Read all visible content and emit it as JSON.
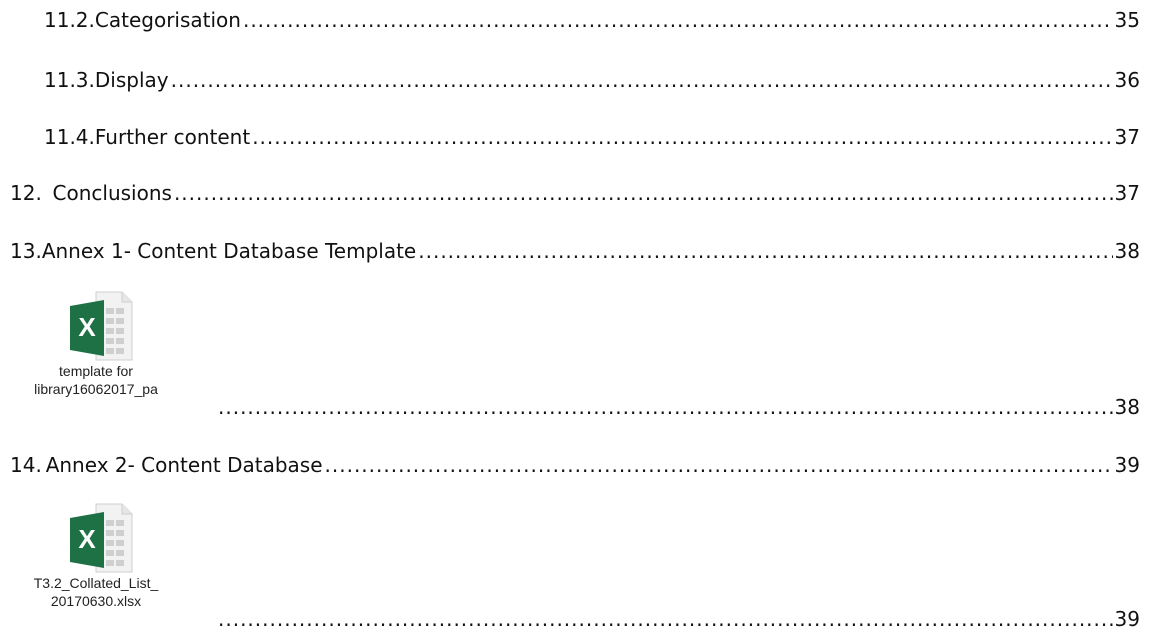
{
  "toc": {
    "entries": [
      {
        "num": "11.2.",
        "title": "Categorisation",
        "page": "35"
      },
      {
        "num": "11.3.",
        "title": "Display",
        "page": "36"
      },
      {
        "num": "11.4.",
        "title": "Further content",
        "page": "37"
      },
      {
        "num": "12.",
        "title": "Conclusions",
        "page": "37"
      },
      {
        "num": "13.",
        "title": "Annex 1- Content Database Template",
        "page": "38"
      },
      {
        "num": "",
        "title": "",
        "page": "38"
      },
      {
        "num": "14.",
        "title": "Annex 2- Content Database",
        "page": "39"
      },
      {
        "num": "",
        "title": "",
        "page": "39"
      }
    ]
  },
  "attachments": [
    {
      "icon": "excel-file-icon",
      "caption_line1": "template for",
      "caption_line2": "library16062017_pa"
    },
    {
      "icon": "excel-file-icon",
      "caption_line1": "T3.2_Collated_List_",
      "caption_line2": "20170630.xlsx"
    }
  ],
  "colors": {
    "excel_green": "#1e7145",
    "sheet_gray": "#cfcfcf"
  }
}
